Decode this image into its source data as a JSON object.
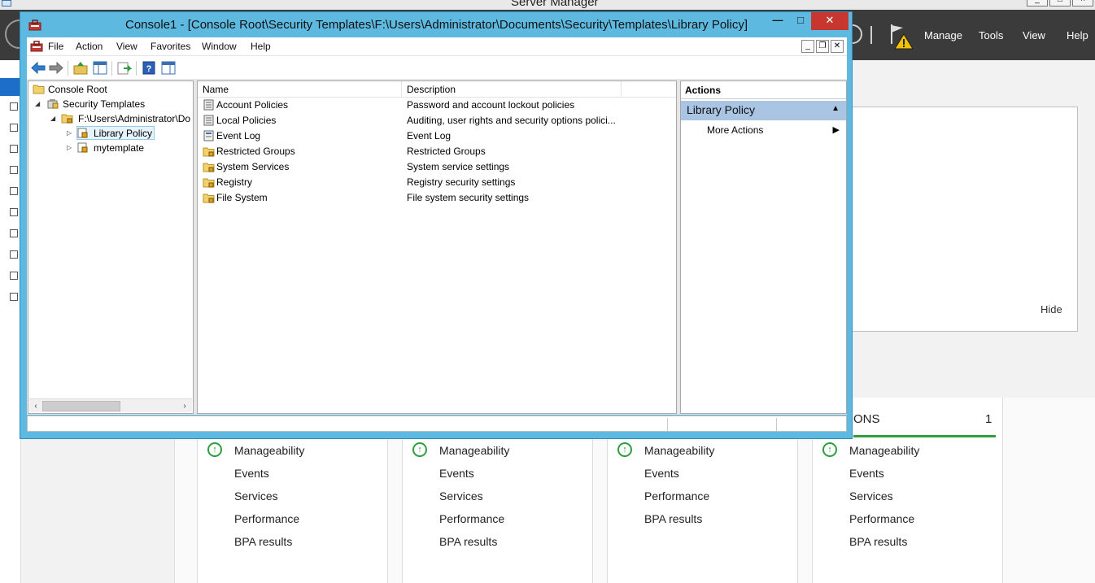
{
  "server_manager": {
    "title": "Server Manager",
    "menu": [
      "Manage",
      "Tools",
      "View",
      "Help"
    ],
    "hide_label": "Hide",
    "tile4_title": "ONS",
    "tile4_count": "1",
    "tiles": [
      [
        "Manageability",
        "Events",
        "Services",
        "Performance",
        "BPA results"
      ],
      [
        "Manageability",
        "Events",
        "Services",
        "Performance",
        "BPA results"
      ],
      [
        "Manageability",
        "Events",
        "Performance",
        "BPA results"
      ],
      [
        "Manageability",
        "Events",
        "Services",
        "Performance",
        "BPA results"
      ]
    ]
  },
  "mmc": {
    "title": "Console1 - [Console Root\\Security Templates\\F:\\Users\\Administrator\\Documents\\Security\\Templates\\Library Policy]",
    "menu": [
      "File",
      "Action",
      "View",
      "Favorites",
      "Window",
      "Help"
    ],
    "tree": {
      "root": "Console Root",
      "security_templates": "Security Templates",
      "path": "F:\\Users\\Administrator\\Do",
      "library_policy": "Library Policy",
      "mytemplate": "mytemplate"
    },
    "list": {
      "columns": [
        "Name",
        "Description"
      ],
      "rows": [
        {
          "name": "Account Policies",
          "description": "Password and account lockout policies"
        },
        {
          "name": "Local Policies",
          "description": "Auditing, user rights and security options polici..."
        },
        {
          "name": "Event Log",
          "description": "Event Log"
        },
        {
          "name": "Restricted Groups",
          "description": "Restricted Groups"
        },
        {
          "name": "System Services",
          "description": "System service settings"
        },
        {
          "name": "Registry",
          "description": "Registry security settings"
        },
        {
          "name": "File System",
          "description": "File system security settings"
        }
      ]
    },
    "actions": {
      "header": "Actions",
      "section": "Library Policy",
      "more": "More Actions"
    }
  },
  "colors": {
    "window_frame": "#5eb9e0",
    "close_button": "#c7372f",
    "server_manager_header": "#3b3b3b",
    "actions_section": "#aac4e4",
    "status_ok_green": "#2e9e3e"
  }
}
